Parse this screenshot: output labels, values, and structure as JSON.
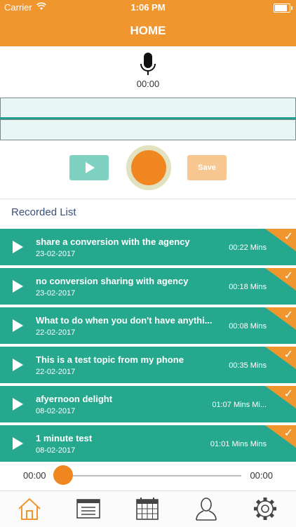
{
  "status_bar": {
    "carrier": "Carrier",
    "time": "1:06 PM",
    "battery_level": 0.95
  },
  "nav": {
    "title": "HOME"
  },
  "recorder": {
    "timer": "00:00",
    "save_label": "Save"
  },
  "list": {
    "header": "Recorded List",
    "items": [
      {
        "title": "share a conversion with the agency",
        "date": "23-02-2017",
        "duration": "00:22 Mins"
      },
      {
        "title": "no conversion sharing with agency",
        "date": "23-02-2017",
        "duration": "00:18 Mins"
      },
      {
        "title": "What to do when you don't have anythi...",
        "date": "22-02-2017",
        "duration": "00:08 Mins"
      },
      {
        "title": "This is a test topic from my phone",
        "date": "22-02-2017",
        "duration": "00:35 Mins"
      },
      {
        "title": "afyernoon delight",
        "date": "08-02-2017",
        "duration": "01:07 Mins Mi..."
      },
      {
        "title": "1 minute test",
        "date": "08-02-2017",
        "duration": "01:01 Mins Mins"
      }
    ]
  },
  "player": {
    "current": "00:00",
    "total": "00:00",
    "progress": 0
  },
  "tabs": [
    {
      "name": "home",
      "icon": "home-icon",
      "active": true
    },
    {
      "name": "list",
      "icon": "list-icon",
      "active": false
    },
    {
      "name": "calendar",
      "icon": "calendar-icon",
      "active": false
    },
    {
      "name": "profile",
      "icon": "user-icon",
      "active": false
    },
    {
      "name": "settings",
      "icon": "gear-icon",
      "active": false
    }
  ],
  "colors": {
    "accent": "#f0962f",
    "teal": "#26a88f",
    "record": "#f08620"
  }
}
